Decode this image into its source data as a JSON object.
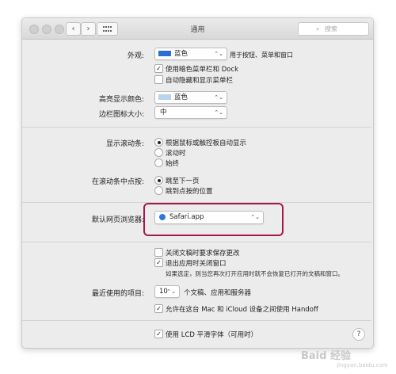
{
  "window": {
    "title": "通用",
    "search_placeholder": "搜索"
  },
  "appearance": {
    "label": "外观:",
    "value": "蓝色",
    "note": "用于按钮、菜单和窗口",
    "dark_menu": "使用暗色菜单栏和 Dock",
    "dark_menu_checked": true,
    "autohide": "自动隐藏和显示菜单栏",
    "autohide_checked": false
  },
  "highlight": {
    "label": "高亮显示颜色:",
    "value": "蓝色",
    "swatch_color": "#b9d2ee"
  },
  "sidebar": {
    "label": "边栏图标大小:",
    "value": "中"
  },
  "scrollbars": {
    "label": "显示滚动条:",
    "options": [
      "根据鼠标或触控板自动显示",
      "滚动时",
      "始终"
    ],
    "selected": 0
  },
  "click_scroll": {
    "label": "在滚动条中点按:",
    "options": [
      "跳至下一页",
      "跳到点按的位置"
    ],
    "selected": 0
  },
  "browser": {
    "label": "默认网页浏览器:",
    "value": "Safari.app"
  },
  "documents": {
    "ask_save": "关闭文稿时要求保存更改",
    "ask_save_checked": false,
    "close_windows": "退出应用时关闭窗口",
    "close_windows_checked": true,
    "note": "如果选定，则当您再次打开应用时就不会恢复已打开的文稿和窗口。"
  },
  "recent": {
    "label": "最近使用的项目:",
    "value": "10",
    "suffix": "个文稿、应用和服务器"
  },
  "handoff": {
    "text": "允许在这台 Mac 和 iCloud 设备之间使用 Handoff",
    "checked": true
  },
  "lcd": {
    "text": "使用 LCD 平滑字体（可用时）",
    "checked": true
  },
  "help": "?",
  "watermark": {
    "main": "Baid 经验",
    "sub": "jingyan.baidu.com"
  },
  "colors": {
    "accent": "#2a6fd6",
    "highlight_border": "#a5174d"
  }
}
